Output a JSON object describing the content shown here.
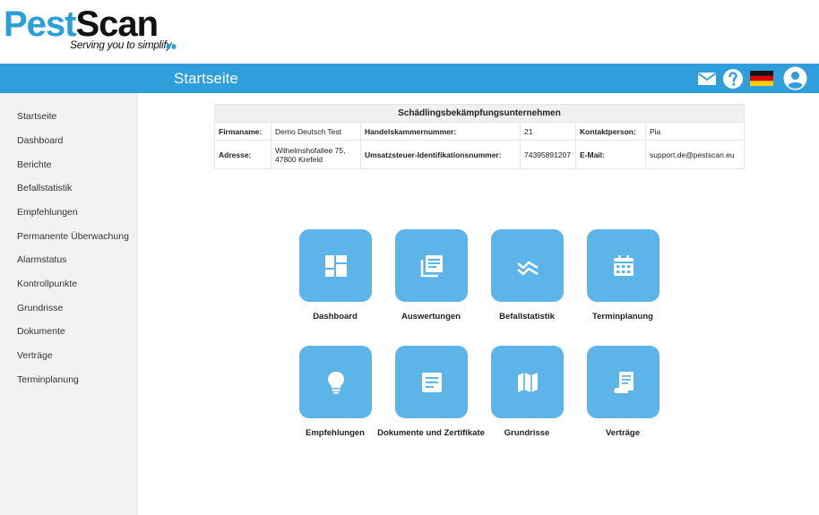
{
  "brand": {
    "name_part1": "Pest",
    "name_part2": "Scan",
    "tagline": "Serving you to simplify"
  },
  "header": {
    "title": "Startseite",
    "icons": [
      "mail-icon",
      "help-icon",
      "german-flag-icon",
      "user-account-icon"
    ]
  },
  "sidebar": {
    "items": [
      {
        "label": "Startseite"
      },
      {
        "label": "Dashboard"
      },
      {
        "label": "Berichte"
      },
      {
        "label": "Befallstatistik"
      },
      {
        "label": "Empfehlungen"
      },
      {
        "label": "Permanente Überwachung"
      },
      {
        "label": "Alarmstatus"
      },
      {
        "label": "Kontrollpunkte"
      },
      {
        "label": "Grundrisse"
      },
      {
        "label": "Dokumente"
      },
      {
        "label": "Verträge"
      },
      {
        "label": "Terminplanung"
      }
    ]
  },
  "company": {
    "heading": "Schädlingsbekämpfungsunternehmen",
    "firmaname_label": "Firmaname:",
    "firmaname": "Demo Deutsch Test",
    "hk_label": "Handelskammernummer:",
    "hk_value": "21",
    "kontakt_label": "Kontaktperson:",
    "kontakt_value": "Pia",
    "adresse_label": "Adresse:",
    "adresse_line1": "Wilhelmshofallee 75,",
    "adresse_line2": "47800 Krefeld",
    "ust_label": "Umsatzsteuer-Identifikationsnummer:",
    "ust_value": "74395891207",
    "email_label": "E-Mail:",
    "email_value": "support.de@pestscan.eu"
  },
  "tiles": [
    {
      "label": "Dashboard",
      "icon": "dashboard-icon"
    },
    {
      "label": "Auswertungen",
      "icon": "reports-icon"
    },
    {
      "label": "Befallstatistik",
      "icon": "statistics-icon"
    },
    {
      "label": "Terminplanung",
      "icon": "calendar-icon"
    },
    {
      "label": "Empfehlungen",
      "icon": "lightbulb-icon"
    },
    {
      "label": "Dokumente und Zertifikate",
      "icon": "document-icon"
    },
    {
      "label": "Grundrisse",
      "icon": "map-icon"
    },
    {
      "label": "Verträge",
      "icon": "contract-icon"
    }
  ],
  "colors": {
    "accent": "#2f9fdc",
    "tile": "#5cb4e8",
    "sidebar_bg": "#f2f2f2"
  }
}
